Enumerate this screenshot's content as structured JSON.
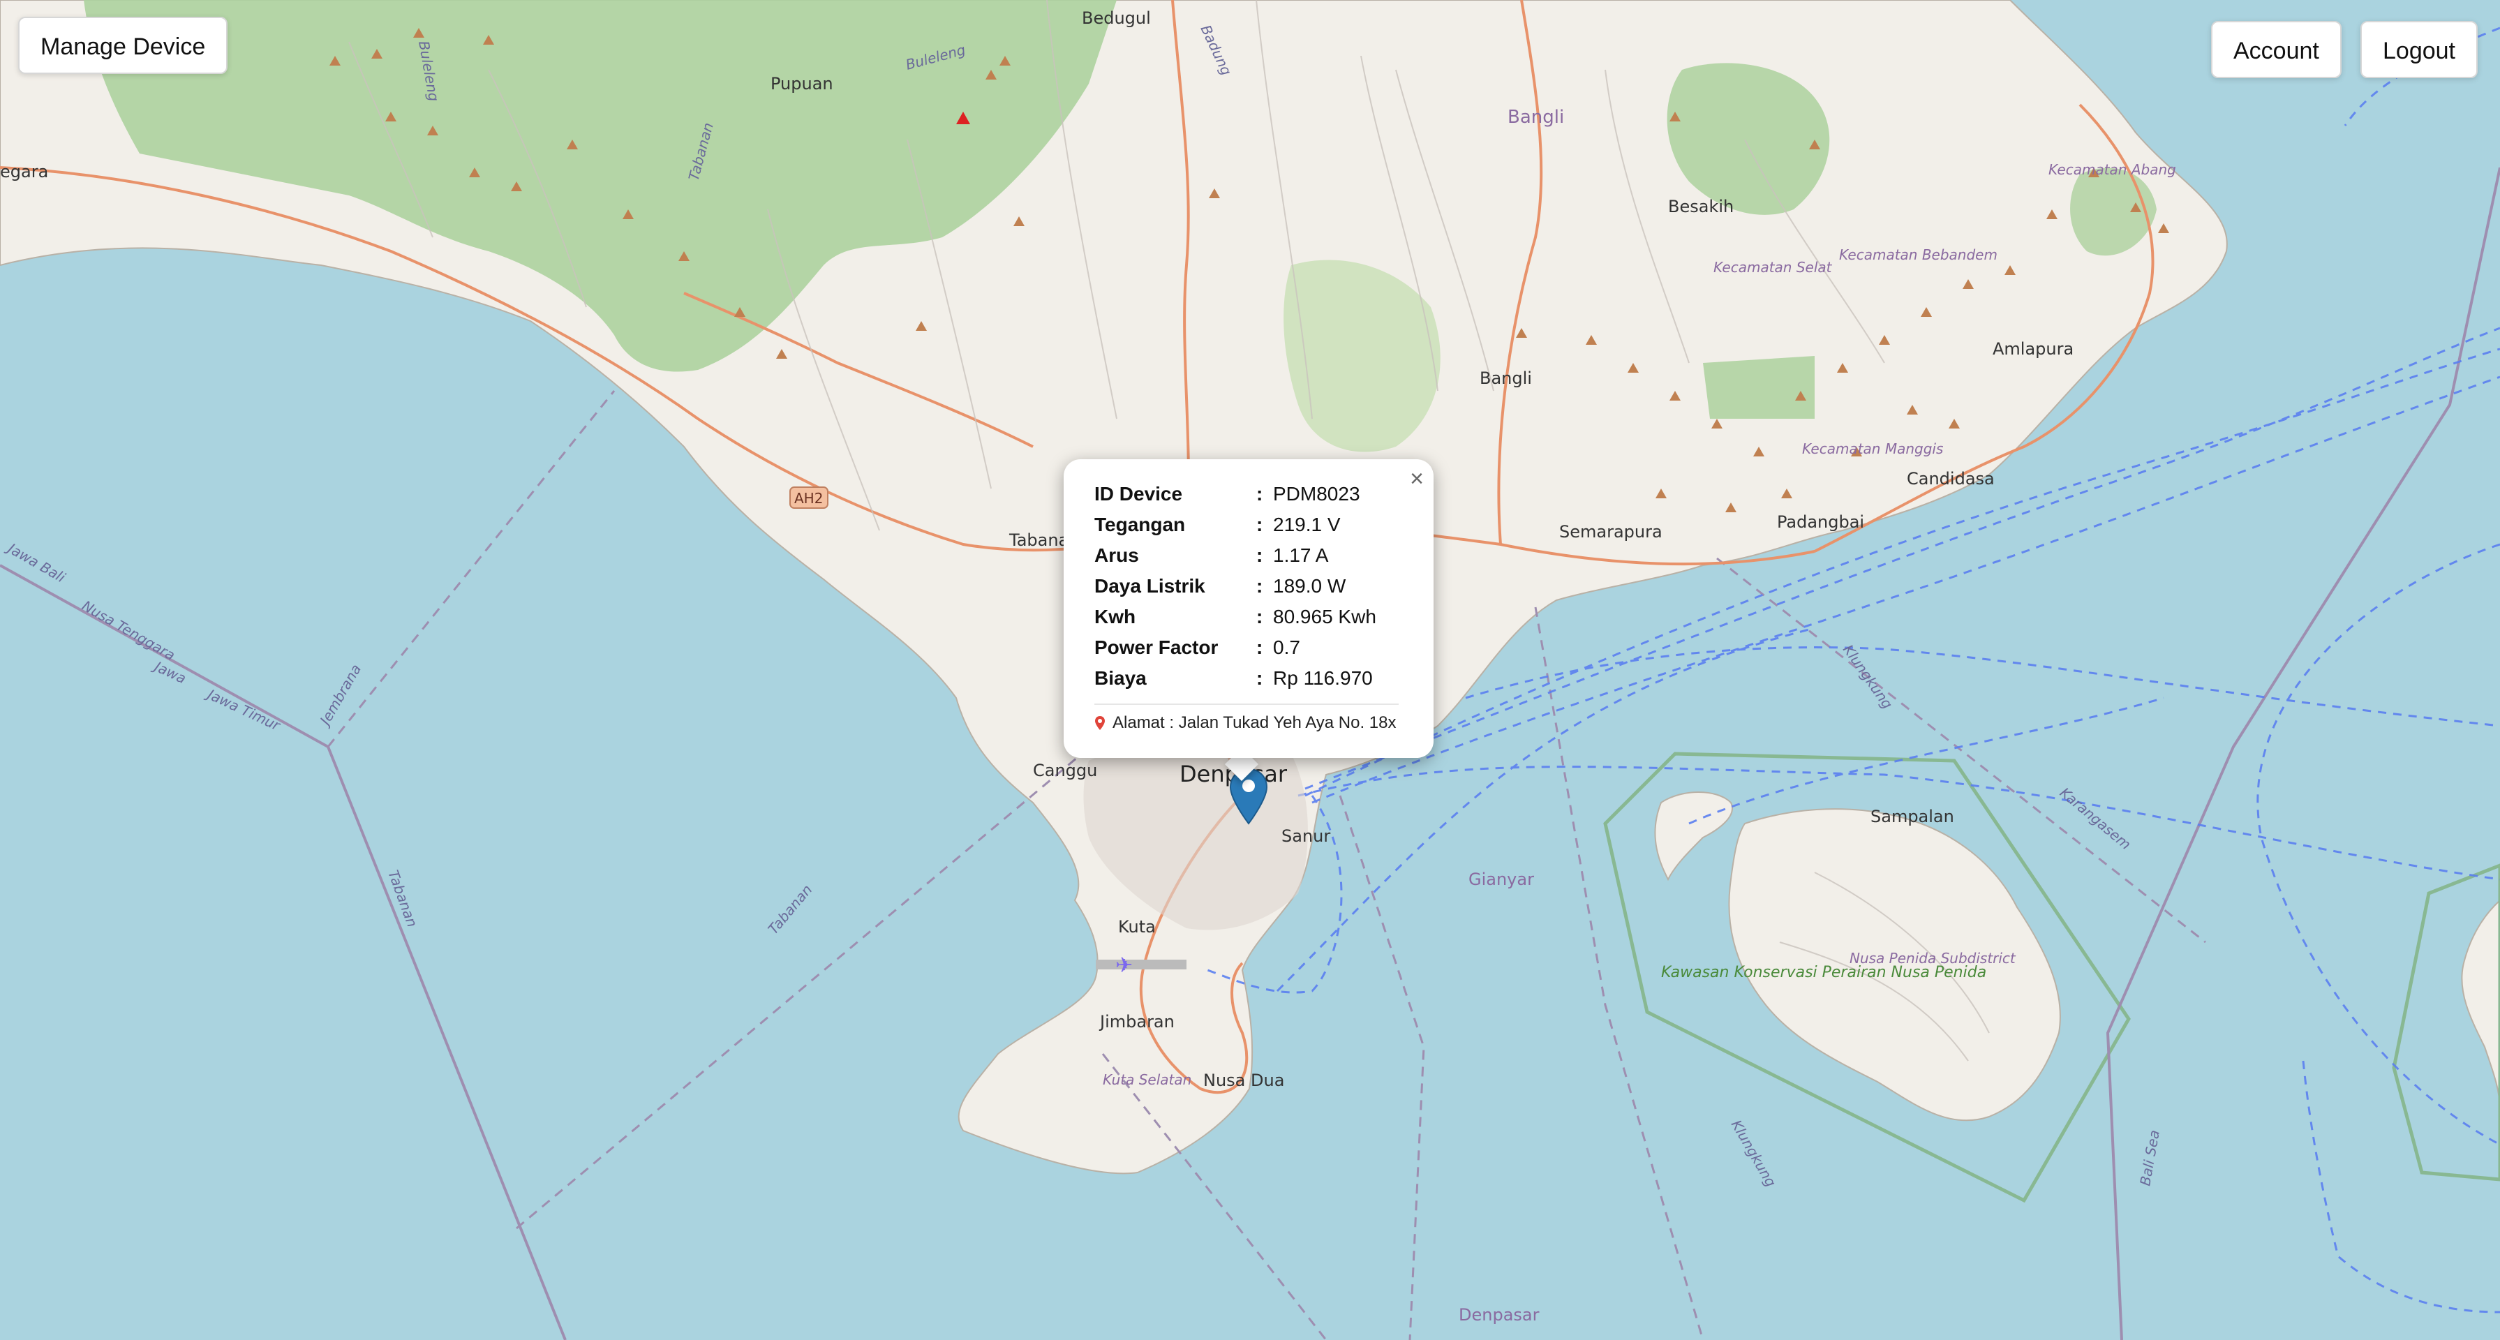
{
  "toolbar": {
    "manage_label": "Manage Device",
    "account_label": "Account",
    "logout_label": "Logout"
  },
  "popup": {
    "close": "×",
    "fields": [
      {
        "key": "ID Device",
        "sep": ":",
        "value": "PDM8023"
      },
      {
        "key": "Tegangan",
        "sep": ":",
        "value": "219.1 V"
      },
      {
        "key": "Arus",
        "sep": ":",
        "value": "1.17 A"
      },
      {
        "key": "Daya Listrik",
        "sep": ":",
        "value": "189.0 W"
      },
      {
        "key": "Kwh",
        "sep": ":",
        "value": "80.965 Kwh"
      },
      {
        "key": "Power Factor",
        "sep": ":",
        "value": "0.7"
      },
      {
        "key": "Biaya",
        "sep": ":",
        "value": "Rp 116.970"
      }
    ],
    "address": "Alamat : Jalan Tukad Yeh Aya No. 18x"
  },
  "map": {
    "colors": {
      "sea": "#aad3df",
      "land": "#f2efe9",
      "forest": "#add19e",
      "road": "#e8926a",
      "boundary": "#9e8eb0",
      "ferry": "#5b7ff0",
      "marker": "#2a7ab8"
    },
    "labels": {
      "bedugul": "Bedugul",
      "pupuan": "Pupuan",
      "buleleng": "Buleleng",
      "buleleng2": "Buleleng",
      "tabanan_r": "Tabanan",
      "badung": "Badung",
      "bangli": "Bangli",
      "bangli2": "Bangli",
      "besakih": "Besakih",
      "kec_selat": "Kecamatan Selat",
      "kec_bebandem": "Kecamatan Bebandem",
      "kec_abang": "Kecamatan Abang",
      "amlapura": "Amlapura",
      "kec_manggis": "Kecamatan Manggis",
      "candidasa": "Candidasa",
      "padangbai": "Padangbai",
      "semarapura": "Semarapura",
      "tabanan": "Tabanan",
      "ah2": "AH2",
      "negara": "egara",
      "nusa_tenggara": "Nusa Tenggara",
      "jawa": "Jawa",
      "jawa_timur": "Jawa Timur",
      "jembrana": "Jembrana",
      "tabanan_sea": "Tabanan",
      "tabanan_sea2": "Tabanan",
      "canggu": "Canggu",
      "denpasar": "Denpasar",
      "sanur": "Sanur",
      "gianyar": "Gianyar",
      "kuta": "Kuta",
      "jimbaran": "Jimbaran",
      "kuta_selatan": "Kuta Selatan",
      "nusa_dua": "Nusa Dua",
      "klungkung": "Klungkung",
      "klungkung2": "Klungkung",
      "karangasem": "Karangasem",
      "sampalan": "Sampalan",
      "nusa_penida_sub": "Nusa Penida Subdistrict",
      "kawasan": "Kawasan Konservasi Perairan Nusa Penida",
      "bali_sea": "Bali Sea",
      "denpasar_bottom": "Denpasar",
      "jawa_bali": "Jawa Bali"
    }
  }
}
